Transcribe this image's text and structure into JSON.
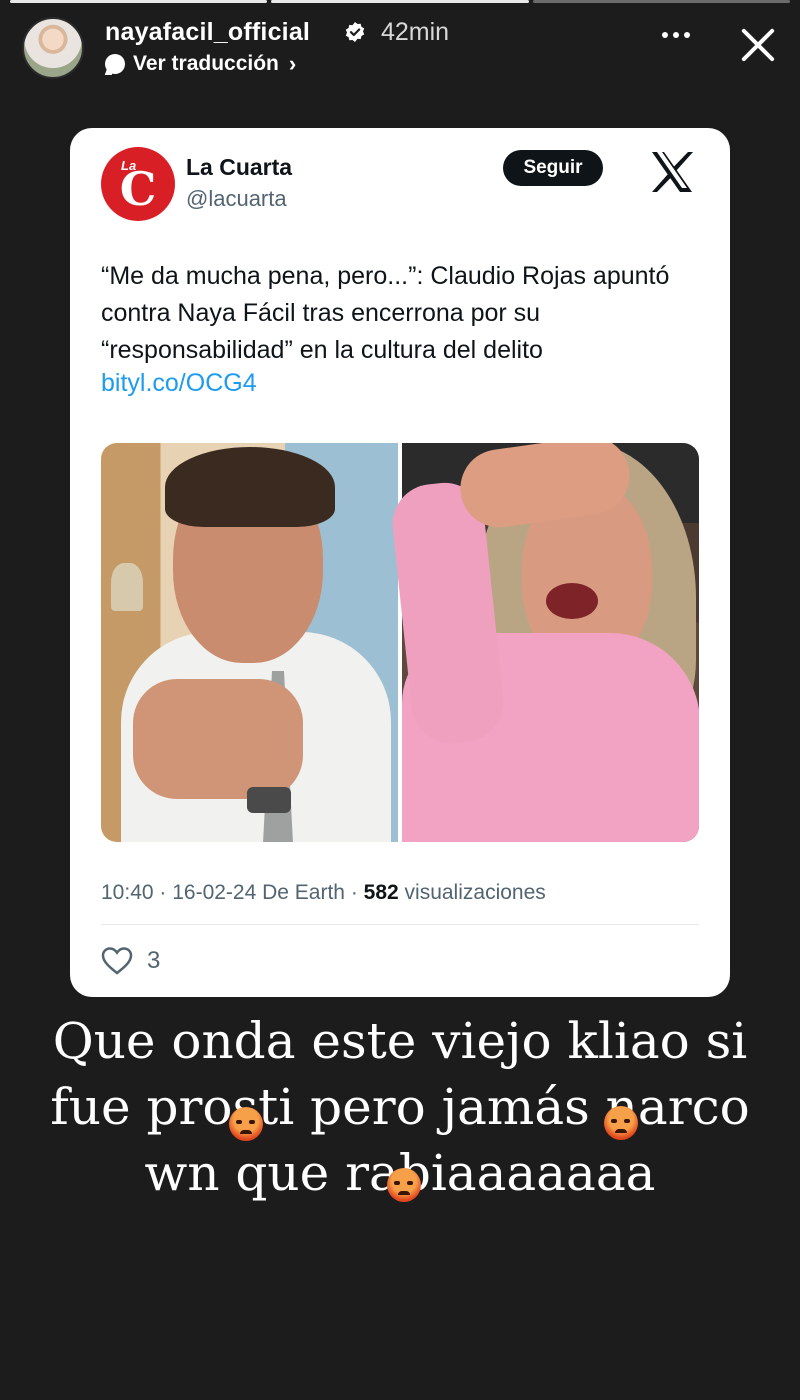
{
  "story": {
    "username": "nayafacil_official",
    "time": "42min",
    "translate_label": "Ver traducción",
    "progress_segments": 3,
    "current_segment": 2
  },
  "tweet": {
    "account_name": "La Cuarta",
    "handle": "@lacuarta",
    "logo_small": "La",
    "logo_letter": "C",
    "follow_label": "Seguir",
    "text": "“Me da mucha pena, pero...”: Claudio Rojas apuntó contra Naya Fácil tras encerrona por su “responsabilidad” en la cultura del delito",
    "link": "bityl.co/OCG4",
    "timestamp": "10:40 · 16-02-24 De Earth · ",
    "views_count": "582",
    "views_label": " visualizaciones",
    "likes": "3",
    "link_color": "#1d9bf0",
    "logo_color": "#d91f26"
  },
  "caption": {
    "line1": "Que onda este viejo kliao si",
    "line2": "fue prosti pero jamás narco",
    "line3": "wn que rabiaaaaaaa"
  },
  "icons": {
    "verified": "verified-badge-icon",
    "translate": "speech-bubble-icon",
    "more": "more-dots-icon",
    "close": "close-icon",
    "x_logo": "x-logo-icon",
    "like": "heart-icon",
    "emoji": "angry-face-emoji"
  }
}
